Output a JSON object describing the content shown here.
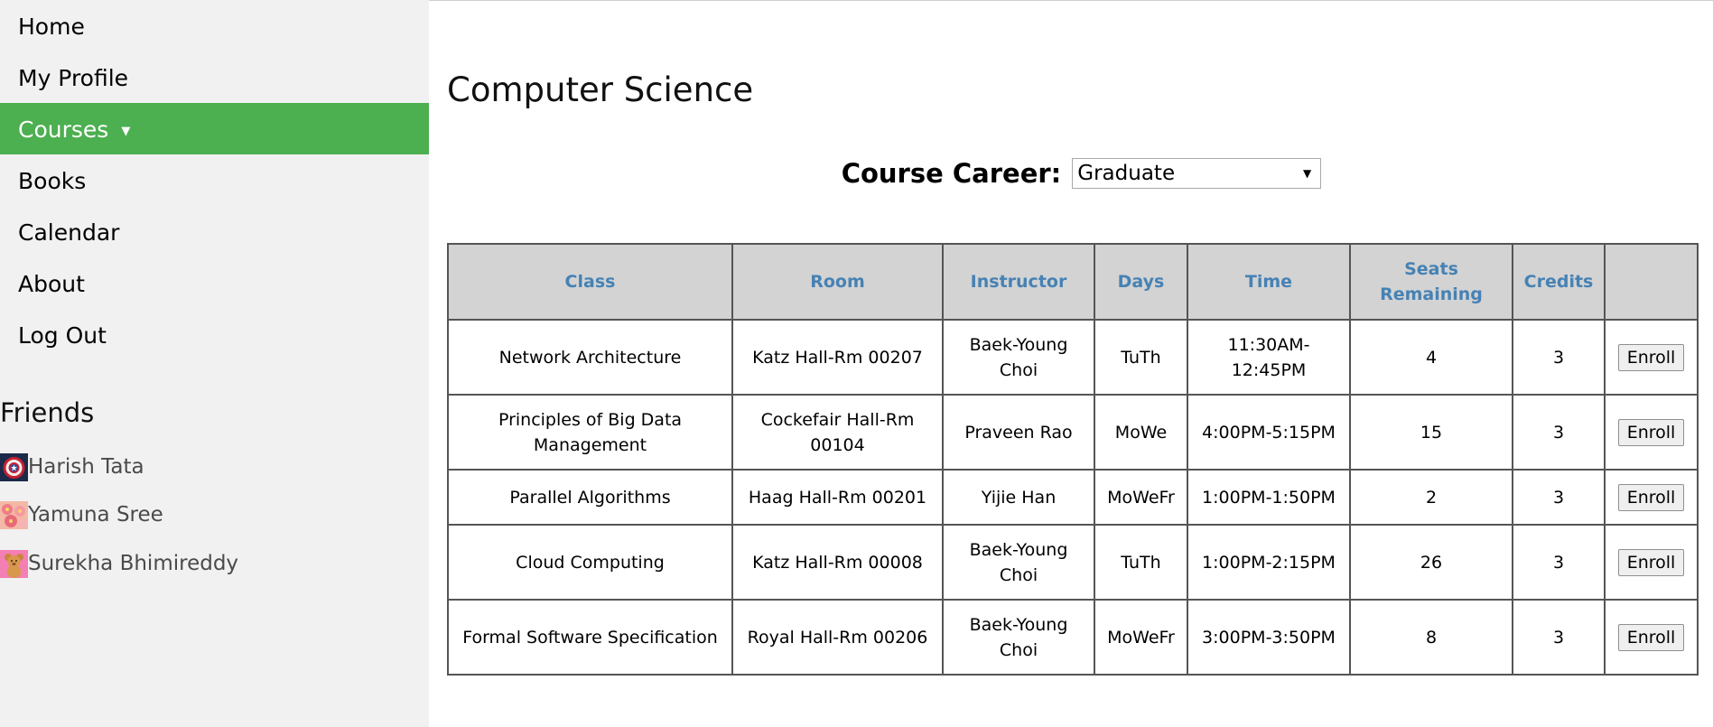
{
  "nav": {
    "items": [
      {
        "label": "Home"
      },
      {
        "label": "My Profile"
      },
      {
        "label": "Courses",
        "caret": "▼",
        "active": true
      },
      {
        "label": "Books"
      },
      {
        "label": "Calendar"
      },
      {
        "label": "About"
      },
      {
        "label": "Log Out"
      }
    ]
  },
  "friends": {
    "title": "Friends",
    "list": [
      {
        "name": "Harish Tata",
        "avatar_icon": "shield-avatar-icon"
      },
      {
        "name": "Yamuna Sree",
        "avatar_icon": "flowers-avatar-icon"
      },
      {
        "name": "Surekha Bhimireddy",
        "avatar_icon": "teddy-bear-avatar-icon"
      }
    ]
  },
  "page": {
    "title": "Computer Science"
  },
  "career": {
    "label": "Course Career:",
    "selected": "Graduate",
    "arrow": "▼"
  },
  "table": {
    "headers": [
      "Class",
      "Room",
      "Instructor",
      "Days",
      "Time",
      "Seats Remaining",
      "Credits",
      ""
    ],
    "rows": [
      {
        "class": "Network Architecture",
        "room": "Katz Hall-Rm 00207",
        "instructor": "Baek-Young Choi",
        "days": "TuTh",
        "time": "11:30AM-12:45PM",
        "seats": "4",
        "credits": "3",
        "action": "Enroll"
      },
      {
        "class": "Principles of Big Data Management",
        "room": "Cockefair Hall-Rm 00104",
        "instructor": "Praveen Rao",
        "days": "MoWe",
        "time": "4:00PM-5:15PM",
        "seats": "15",
        "credits": "3",
        "action": "Enroll"
      },
      {
        "class": "Parallel Algorithms",
        "room": "Haag Hall-Rm 00201",
        "instructor": "Yijie Han",
        "days": "MoWeFr",
        "time": "1:00PM-1:50PM",
        "seats": "2",
        "credits": "3",
        "action": "Enroll"
      },
      {
        "class": "Cloud Computing",
        "room": "Katz Hall-Rm 00008",
        "instructor": "Baek-Young Choi",
        "days": "TuTh",
        "time": "1:00PM-2:15PM",
        "seats": "26",
        "credits": "3",
        "action": "Enroll"
      },
      {
        "class": "Formal Software Specification",
        "room": "Royal Hall-Rm 00206",
        "instructor": "Baek-Young Choi",
        "days": "MoWeFr",
        "time": "3:00PM-3:50PM",
        "seats": "8",
        "credits": "3",
        "action": "Enroll"
      }
    ]
  },
  "colors": {
    "active_nav": "#4caf50",
    "sidebar_bg": "#f1f1f1",
    "header_bg": "#d3d3d3",
    "header_text": "#4682b4"
  }
}
